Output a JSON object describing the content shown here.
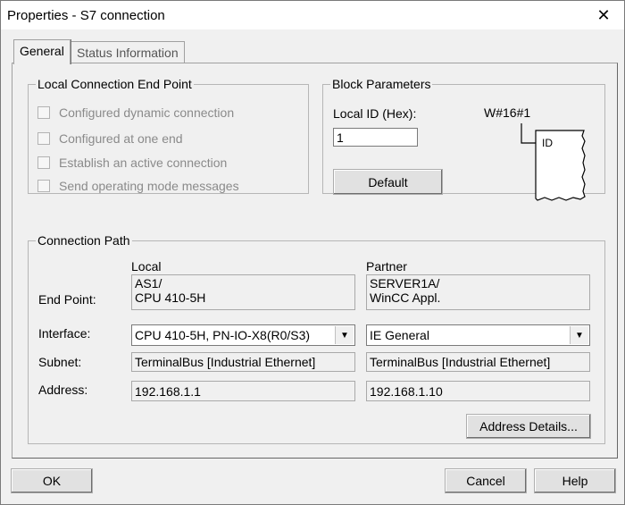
{
  "window": {
    "title": "Properties - S7 connection",
    "close_glyph": "✕"
  },
  "tabs": [
    {
      "label": "General",
      "active": true
    },
    {
      "label": "Status Information",
      "active": false
    }
  ],
  "local_end_point": {
    "legend": "Local Connection End Point",
    "options": [
      {
        "label": "Configured dynamic connection",
        "checked": false,
        "enabled": false
      },
      {
        "label": "Configured at one end",
        "checked": false,
        "enabled": false
      },
      {
        "label": "Establish an active connection",
        "checked": false,
        "enabled": false
      },
      {
        "label": "Send operating mode messages",
        "checked": false,
        "enabled": false
      }
    ]
  },
  "block_params": {
    "legend": "Block Parameters",
    "local_id_label": "Local ID (Hex):",
    "local_id_value": "1",
    "default_label": "Default",
    "diagram_label": "W#16#1",
    "diagram_box_text": "ID"
  },
  "connection_path": {
    "legend": "Connection Path",
    "local_header": "Local",
    "partner_header": "Partner",
    "end_point_label": "End Point:",
    "interface_label": "Interface:",
    "subnet_label": "Subnet:",
    "address_label": "Address:",
    "local": {
      "end_point_line1": "AS1/",
      "end_point_line2": "CPU 410-5H",
      "interface": "CPU 410-5H, PN-IO-X8(R0/S3)",
      "subnet": "TerminalBus [Industrial Ethernet]",
      "address": "192.168.1.1"
    },
    "partner": {
      "end_point_line1": "SERVER1A/",
      "end_point_line2": "WinCC Appl.",
      "interface": "IE General",
      "subnet": "TerminalBus [Industrial Ethernet]",
      "address": "192.168.1.10"
    },
    "address_details_label": "Address Details..."
  },
  "footer": {
    "ok_label": "OK",
    "cancel_label": "Cancel",
    "help_label": "Help"
  }
}
